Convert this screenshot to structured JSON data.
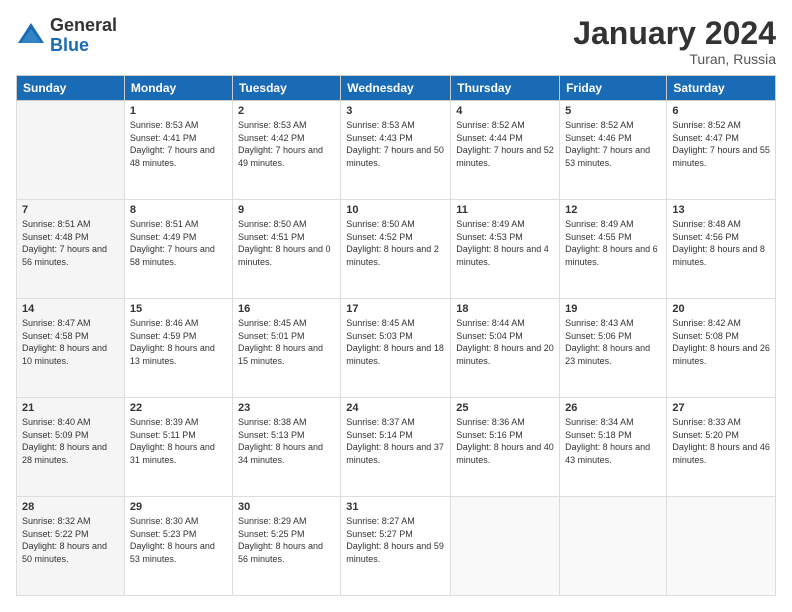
{
  "logo": {
    "general": "General",
    "blue": "Blue"
  },
  "header": {
    "title": "January 2024",
    "subtitle": "Turan, Russia"
  },
  "weekdays": [
    "Sunday",
    "Monday",
    "Tuesday",
    "Wednesday",
    "Thursday",
    "Friday",
    "Saturday"
  ],
  "weeks": [
    [
      {
        "day": "",
        "sunrise": "",
        "sunset": "",
        "daylight": ""
      },
      {
        "day": "1",
        "sunrise": "Sunrise: 8:53 AM",
        "sunset": "Sunset: 4:41 PM",
        "daylight": "Daylight: 7 hours and 48 minutes."
      },
      {
        "day": "2",
        "sunrise": "Sunrise: 8:53 AM",
        "sunset": "Sunset: 4:42 PM",
        "daylight": "Daylight: 7 hours and 49 minutes."
      },
      {
        "day": "3",
        "sunrise": "Sunrise: 8:53 AM",
        "sunset": "Sunset: 4:43 PM",
        "daylight": "Daylight: 7 hours and 50 minutes."
      },
      {
        "day": "4",
        "sunrise": "Sunrise: 8:52 AM",
        "sunset": "Sunset: 4:44 PM",
        "daylight": "Daylight: 7 hours and 52 minutes."
      },
      {
        "day": "5",
        "sunrise": "Sunrise: 8:52 AM",
        "sunset": "Sunset: 4:46 PM",
        "daylight": "Daylight: 7 hours and 53 minutes."
      },
      {
        "day": "6",
        "sunrise": "Sunrise: 8:52 AM",
        "sunset": "Sunset: 4:47 PM",
        "daylight": "Daylight: 7 hours and 55 minutes."
      }
    ],
    [
      {
        "day": "7",
        "sunrise": "Sunrise: 8:51 AM",
        "sunset": "Sunset: 4:48 PM",
        "daylight": "Daylight: 7 hours and 56 minutes."
      },
      {
        "day": "8",
        "sunrise": "Sunrise: 8:51 AM",
        "sunset": "Sunset: 4:49 PM",
        "daylight": "Daylight: 7 hours and 58 minutes."
      },
      {
        "day": "9",
        "sunrise": "Sunrise: 8:50 AM",
        "sunset": "Sunset: 4:51 PM",
        "daylight": "Daylight: 8 hours and 0 minutes."
      },
      {
        "day": "10",
        "sunrise": "Sunrise: 8:50 AM",
        "sunset": "Sunset: 4:52 PM",
        "daylight": "Daylight: 8 hours and 2 minutes."
      },
      {
        "day": "11",
        "sunrise": "Sunrise: 8:49 AM",
        "sunset": "Sunset: 4:53 PM",
        "daylight": "Daylight: 8 hours and 4 minutes."
      },
      {
        "day": "12",
        "sunrise": "Sunrise: 8:49 AM",
        "sunset": "Sunset: 4:55 PM",
        "daylight": "Daylight: 8 hours and 6 minutes."
      },
      {
        "day": "13",
        "sunrise": "Sunrise: 8:48 AM",
        "sunset": "Sunset: 4:56 PM",
        "daylight": "Daylight: 8 hours and 8 minutes."
      }
    ],
    [
      {
        "day": "14",
        "sunrise": "Sunrise: 8:47 AM",
        "sunset": "Sunset: 4:58 PM",
        "daylight": "Daylight: 8 hours and 10 minutes."
      },
      {
        "day": "15",
        "sunrise": "Sunrise: 8:46 AM",
        "sunset": "Sunset: 4:59 PM",
        "daylight": "Daylight: 8 hours and 13 minutes."
      },
      {
        "day": "16",
        "sunrise": "Sunrise: 8:45 AM",
        "sunset": "Sunset: 5:01 PM",
        "daylight": "Daylight: 8 hours and 15 minutes."
      },
      {
        "day": "17",
        "sunrise": "Sunrise: 8:45 AM",
        "sunset": "Sunset: 5:03 PM",
        "daylight": "Daylight: 8 hours and 18 minutes."
      },
      {
        "day": "18",
        "sunrise": "Sunrise: 8:44 AM",
        "sunset": "Sunset: 5:04 PM",
        "daylight": "Daylight: 8 hours and 20 minutes."
      },
      {
        "day": "19",
        "sunrise": "Sunrise: 8:43 AM",
        "sunset": "Sunset: 5:06 PM",
        "daylight": "Daylight: 8 hours and 23 minutes."
      },
      {
        "day": "20",
        "sunrise": "Sunrise: 8:42 AM",
        "sunset": "Sunset: 5:08 PM",
        "daylight": "Daylight: 8 hours and 26 minutes."
      }
    ],
    [
      {
        "day": "21",
        "sunrise": "Sunrise: 8:40 AM",
        "sunset": "Sunset: 5:09 PM",
        "daylight": "Daylight: 8 hours and 28 minutes."
      },
      {
        "day": "22",
        "sunrise": "Sunrise: 8:39 AM",
        "sunset": "Sunset: 5:11 PM",
        "daylight": "Daylight: 8 hours and 31 minutes."
      },
      {
        "day": "23",
        "sunrise": "Sunrise: 8:38 AM",
        "sunset": "Sunset: 5:13 PM",
        "daylight": "Daylight: 8 hours and 34 minutes."
      },
      {
        "day": "24",
        "sunrise": "Sunrise: 8:37 AM",
        "sunset": "Sunset: 5:14 PM",
        "daylight": "Daylight: 8 hours and 37 minutes."
      },
      {
        "day": "25",
        "sunrise": "Sunrise: 8:36 AM",
        "sunset": "Sunset: 5:16 PM",
        "daylight": "Daylight: 8 hours and 40 minutes."
      },
      {
        "day": "26",
        "sunrise": "Sunrise: 8:34 AM",
        "sunset": "Sunset: 5:18 PM",
        "daylight": "Daylight: 8 hours and 43 minutes."
      },
      {
        "day": "27",
        "sunrise": "Sunrise: 8:33 AM",
        "sunset": "Sunset: 5:20 PM",
        "daylight": "Daylight: 8 hours and 46 minutes."
      }
    ],
    [
      {
        "day": "28",
        "sunrise": "Sunrise: 8:32 AM",
        "sunset": "Sunset: 5:22 PM",
        "daylight": "Daylight: 8 hours and 50 minutes."
      },
      {
        "day": "29",
        "sunrise": "Sunrise: 8:30 AM",
        "sunset": "Sunset: 5:23 PM",
        "daylight": "Daylight: 8 hours and 53 minutes."
      },
      {
        "day": "30",
        "sunrise": "Sunrise: 8:29 AM",
        "sunset": "Sunset: 5:25 PM",
        "daylight": "Daylight: 8 hours and 56 minutes."
      },
      {
        "day": "31",
        "sunrise": "Sunrise: 8:27 AM",
        "sunset": "Sunset: 5:27 PM",
        "daylight": "Daylight: 8 hours and 59 minutes."
      },
      {
        "day": "",
        "sunrise": "",
        "sunset": "",
        "daylight": ""
      },
      {
        "day": "",
        "sunrise": "",
        "sunset": "",
        "daylight": ""
      },
      {
        "day": "",
        "sunrise": "",
        "sunset": "",
        "daylight": ""
      }
    ]
  ]
}
